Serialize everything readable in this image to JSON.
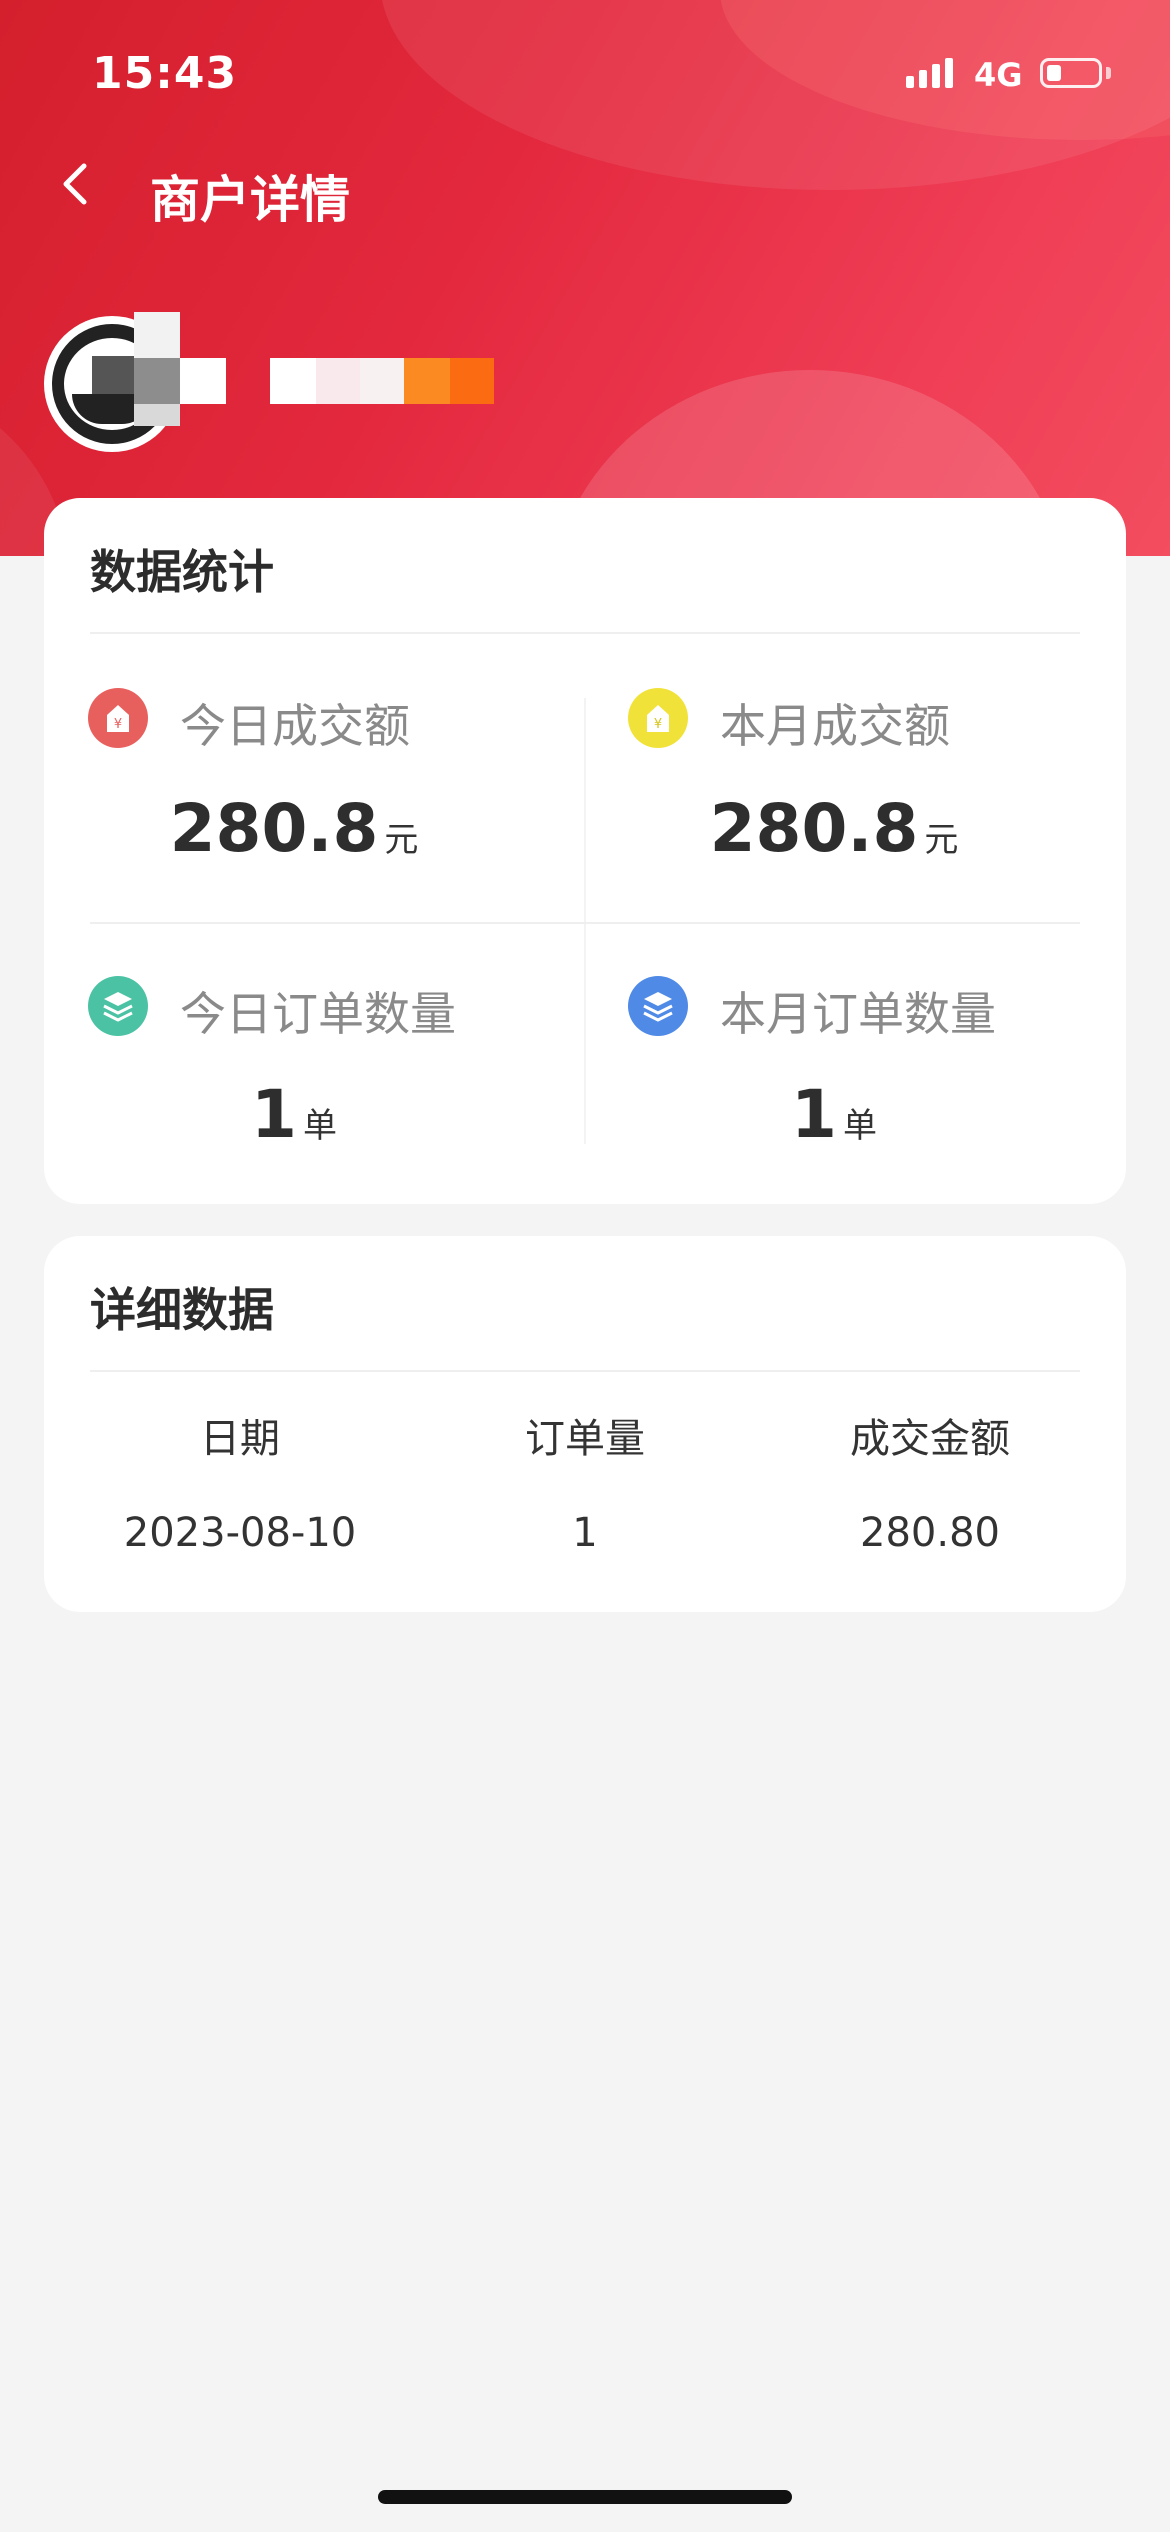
{
  "status_bar": {
    "time": "15:43",
    "network": "4G"
  },
  "header": {
    "title": "商户详情"
  },
  "stats_card": {
    "title": "数据统计",
    "items": [
      {
        "label": "今日成交额",
        "value": "280.8",
        "unit": "元",
        "icon": "money-tag-icon",
        "color": "#e8605e"
      },
      {
        "label": "本月成交额",
        "value": "280.8",
        "unit": "元",
        "icon": "money-tag-icon",
        "color": "#f1e23a"
      },
      {
        "label": "今日订单数量",
        "value": "1",
        "unit": "单",
        "icon": "layers-icon",
        "color": "#4cc2a4"
      },
      {
        "label": "本月订单数量",
        "value": "1",
        "unit": "单",
        "icon": "layers-icon",
        "color": "#4f8ae6"
      }
    ]
  },
  "detail_card": {
    "title": "详细数据",
    "columns": [
      "日期",
      "订单量",
      "成交金额"
    ],
    "rows": [
      [
        "2023-08-10",
        "1",
        "280.80"
      ]
    ]
  },
  "colors": {
    "header_red": "#e3283d",
    "background": "#f4f4f4"
  }
}
